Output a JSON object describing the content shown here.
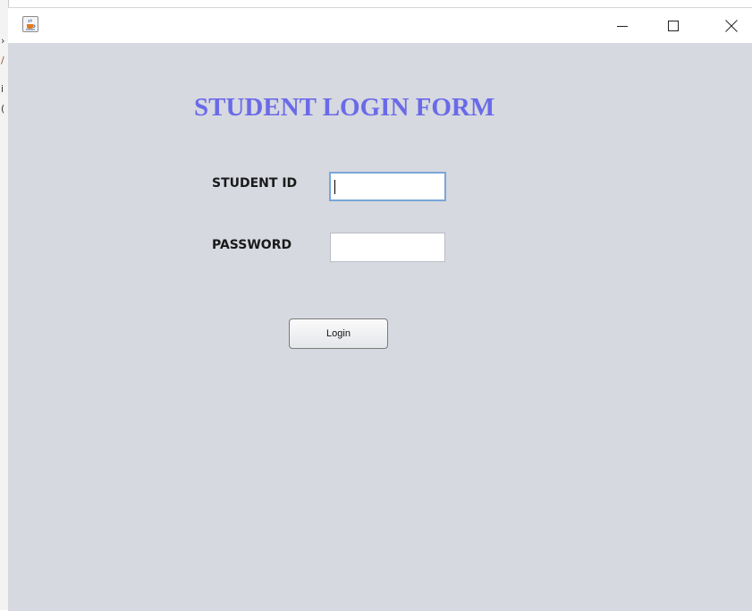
{
  "window": {
    "title": "",
    "icon": "java-cup-icon",
    "controls": {
      "minimize": "—",
      "maximize": "☐",
      "close": "✕"
    }
  },
  "form": {
    "title": "STUDENT LOGIN FORM",
    "title_color": "#6a6ae8",
    "background_color": "#d6d9e0",
    "student_id": {
      "label": "STUDENT ID",
      "value": "",
      "focused": true
    },
    "password": {
      "label": "PASSWORD",
      "value": ""
    },
    "login_button": {
      "label": "Login"
    }
  }
}
